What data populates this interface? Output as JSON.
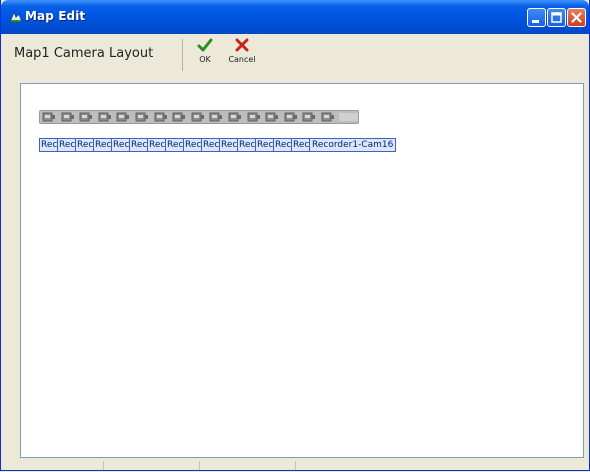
{
  "window": {
    "title": "Map Edit",
    "icon": "map-edit-icon",
    "controls": {
      "minimize": "minimize-icon",
      "maximize": "maximize-icon",
      "close": "close-icon"
    }
  },
  "toolbar": {
    "layout_name": "Map1 Camera Layout",
    "ok_label": "OK",
    "cancel_label": "Cancel",
    "ok_icon": "checkmark-icon",
    "cancel_icon": "x-icon",
    "colors": {
      "ok": "#2d8c1e",
      "cancel": "#c8221c"
    }
  },
  "map": {
    "camera_count": 16,
    "camera_labels": [
      {
        "text": "Rec",
        "truncated": true
      },
      {
        "text": "Rec",
        "truncated": true
      },
      {
        "text": "Rec",
        "truncated": true
      },
      {
        "text": "Rec",
        "truncated": true
      },
      {
        "text": "Rec",
        "truncated": true
      },
      {
        "text": "Rec",
        "truncated": true
      },
      {
        "text": "Rec",
        "truncated": true
      },
      {
        "text": "Rec",
        "truncated": true
      },
      {
        "text": "Rec",
        "truncated": true
      },
      {
        "text": "Rec",
        "truncated": true
      },
      {
        "text": "Rec",
        "truncated": true
      },
      {
        "text": "Rec",
        "truncated": true
      },
      {
        "text": "Rec",
        "truncated": true
      },
      {
        "text": "Rec",
        "truncated": true
      },
      {
        "text": "Rec",
        "truncated": true
      },
      {
        "text": "Recorder1-Cam16",
        "truncated": false
      }
    ],
    "colors": {
      "label_bg": "#d9e8ff",
      "label_border": "#3b64c2",
      "label_text": "#0d1b6b"
    }
  }
}
